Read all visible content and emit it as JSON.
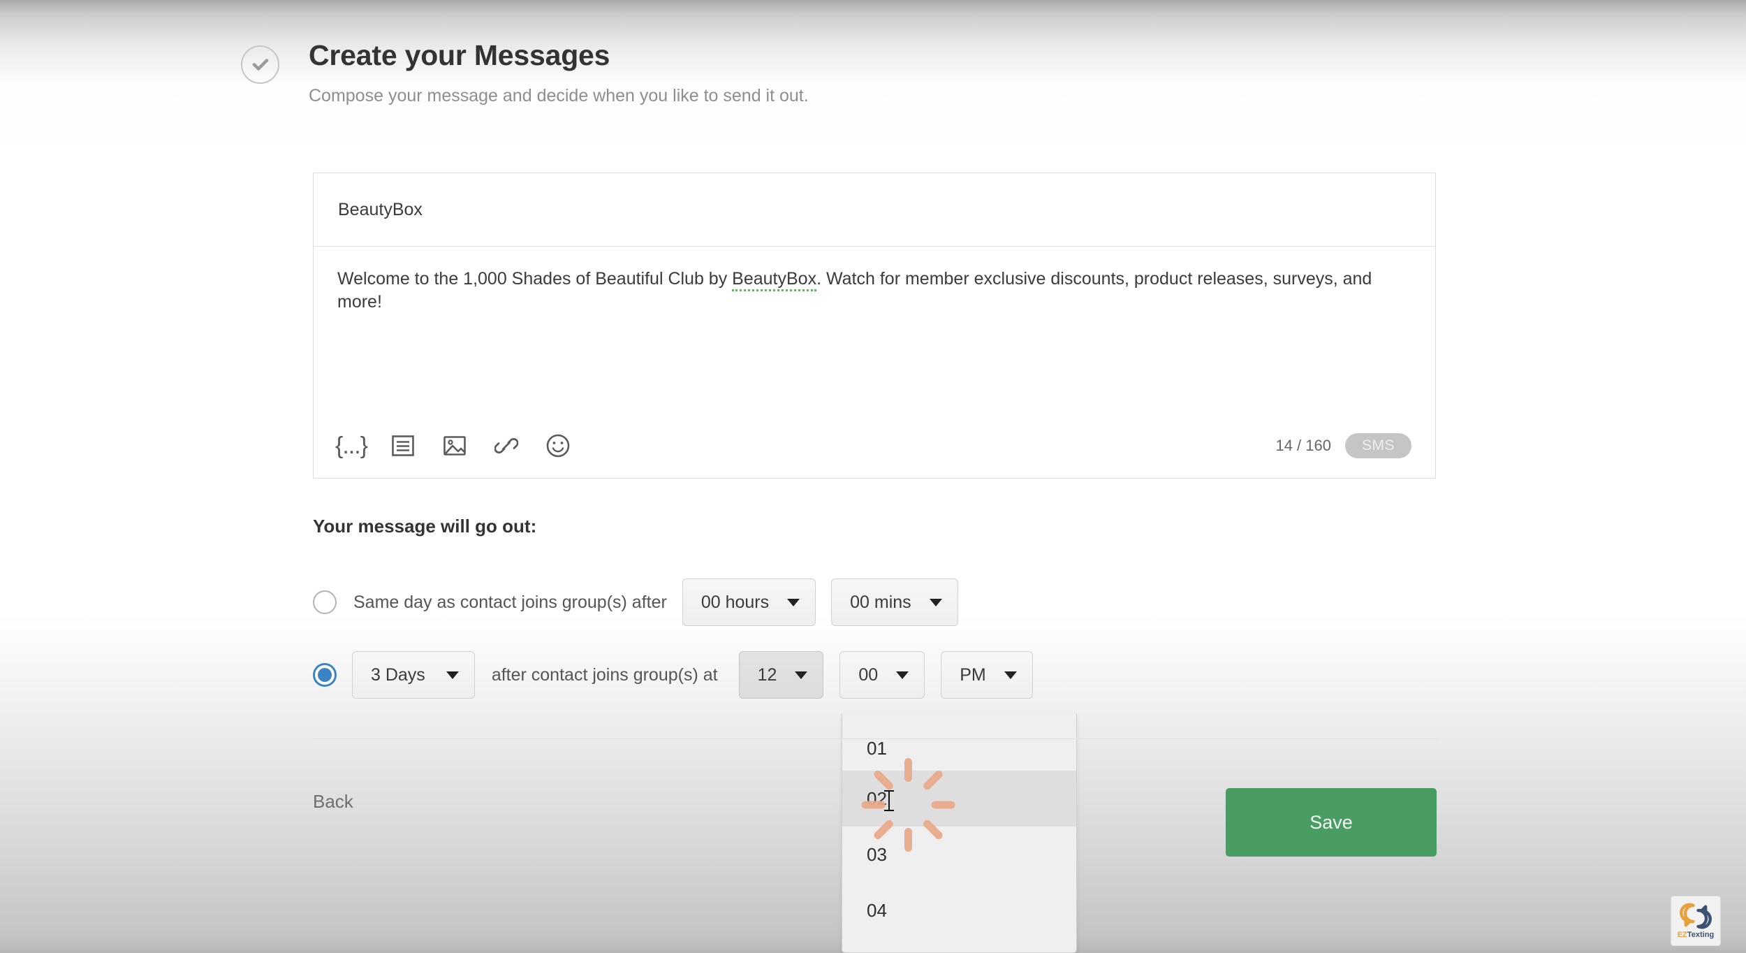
{
  "header": {
    "step_icon": "check-circle-icon",
    "title": "Create your Messages",
    "subtitle": "Compose your message and decide when you like to send it out."
  },
  "composer": {
    "subject_value": "BeautyBox",
    "body_before": "Welcome to the 1,000 Shades of Beautiful Club by ",
    "body_misspelled": "BeautyBox",
    "body_after": ". Watch for member exclusive discounts, product releases, surveys, and more!",
    "toolbar": [
      {
        "icon": "merge-field-icon",
        "label": "{...}"
      },
      {
        "icon": "template-icon",
        "label": ""
      },
      {
        "icon": "image-icon",
        "label": ""
      },
      {
        "icon": "link-icon",
        "label": ""
      },
      {
        "icon": "emoji-icon",
        "label": ""
      }
    ],
    "char_counter": "14 / 160",
    "message_type_badge": "SMS"
  },
  "schedule": {
    "section_label": "Your message will go out:",
    "option_same_day": {
      "selected": false,
      "text": "Same day as contact joins group(s) after",
      "hours_select": "00 hours",
      "mins_select": "00 mins"
    },
    "option_delayed": {
      "selected": true,
      "days_select": "3 Days",
      "text": "after contact joins group(s) at",
      "hour_select": "12",
      "minute_select": "00",
      "ampm_select": "PM"
    }
  },
  "hour_dropdown": {
    "open": true,
    "loading": true,
    "hovered_index": 1,
    "items": [
      "01",
      "02",
      "03",
      "04"
    ]
  },
  "footer": {
    "back_label": "Back",
    "save_label": "Save"
  },
  "branding": {
    "logo_ez": "EZ",
    "logo_texting": "Texting"
  },
  "colors": {
    "save_green": "#4a9d62",
    "radio_blue": "#3b84c4",
    "spinner_salmon": "#e8a98a",
    "spellcheck_green": "#5cb85c",
    "badge_gray": "#c3c5c7"
  }
}
